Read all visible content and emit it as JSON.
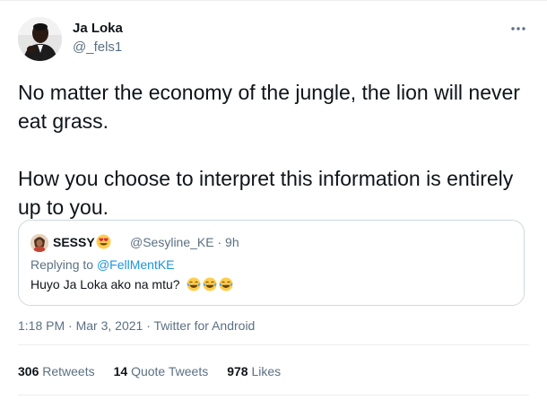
{
  "author": {
    "name": "Ja Loka",
    "handle": "@_fels1"
  },
  "tweet": {
    "line1": "No matter the economy of the jungle, the lion will never eat grass.",
    "line2": "How you choose to interpret this information is entirely up to you."
  },
  "quote": {
    "name": "SESSY",
    "handle": "@Sesyline_KE",
    "sep": "·",
    "time": "9h",
    "replying_prefix": "Replying to ",
    "replying_to": "@FellMentKE",
    "text": "Huyo Ja Loka ako na mtu?"
  },
  "meta": {
    "time": "1:18 PM",
    "sep": "·",
    "date": "Mar 3, 2021",
    "source": "Twitter for Android"
  },
  "stats": {
    "retweets_count": "306",
    "retweets_label": "Retweets",
    "quotes_count": "14",
    "quotes_label": "Quote Tweets",
    "likes_count": "978",
    "likes_label": "Likes"
  },
  "colors": {
    "text": "#0f1419",
    "secondary": "#5b7083",
    "link": "#1b95e0",
    "border": "#cfd9de"
  },
  "icons": {
    "more": "more-horizontal-icon",
    "quote_name_emoji": "heart-eyes-emoji",
    "laugh": "tears-of-joy-emoji"
  }
}
